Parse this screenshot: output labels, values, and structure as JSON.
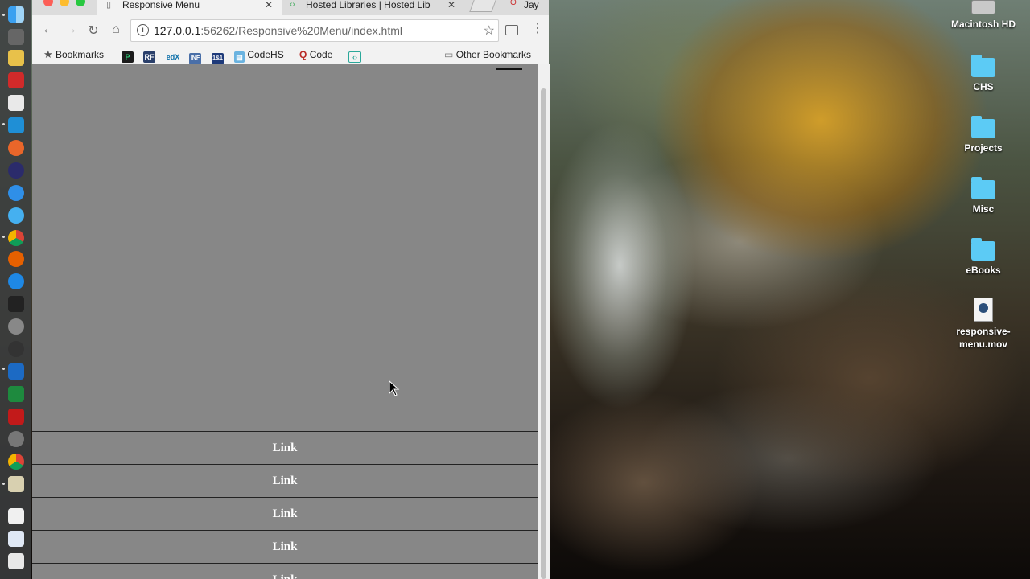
{
  "browser": {
    "tabs": [
      {
        "title": "Responsive Menu",
        "active": true
      },
      {
        "title": "Hosted Libraries  |  Hosted Lib",
        "active": false
      }
    ],
    "profile_name": "Jay",
    "close_glyph": "✕",
    "url_host": "127.0.0.1",
    "url_rest": ":56262/Responsive%20Menu/index.html",
    "bookmarks": {
      "bookmarks_label": "Bookmarks",
      "codehs_label": "CodeHS",
      "code_label": "Code",
      "other_label": "Other Bookmarks",
      "icon_text": {
        "rf": "RF",
        "edx": "edX",
        "inf": "INF",
        "oneandone": "1&1"
      }
    }
  },
  "page": {
    "menu_links": [
      "Link",
      "Link",
      "Link",
      "Link",
      "Link"
    ]
  },
  "desktop": {
    "icons": [
      {
        "label": "Macintosh HD",
        "kind": "drive"
      },
      {
        "label": "CHS",
        "kind": "folder"
      },
      {
        "label": "Projects",
        "kind": "folder"
      },
      {
        "label": "Misc",
        "kind": "folder"
      },
      {
        "label": "eBooks",
        "kind": "folder"
      },
      {
        "label": "responsive-menu.mov",
        "kind": "movie"
      }
    ]
  },
  "colors": {
    "page_background": "#878787",
    "folder_blue": "#5ccbf5",
    "menu_text": "#ffffff"
  }
}
